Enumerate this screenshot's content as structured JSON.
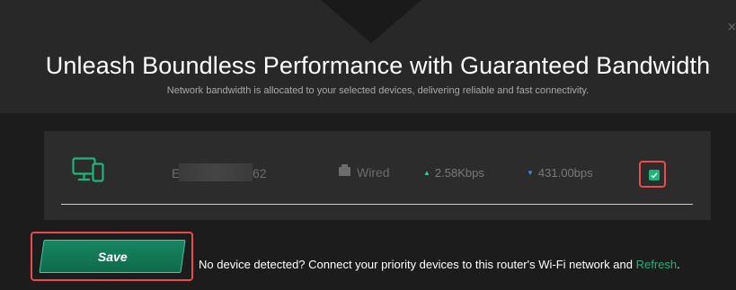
{
  "header": {
    "close_glyph": "×",
    "title": "Unleash Boundless Performance with Guaranteed Bandwidth",
    "subtitle": "Network bandwidth is allocated to your selected devices, delivering reliable and fast connectivity."
  },
  "device": {
    "icon": "devices-icon",
    "name_prefix": "E\\",
    "name_suffix": "62",
    "connection": "Wired",
    "connection_icon": "wired-icon",
    "upload_rate": "2.58Kbps",
    "download_rate": "431.00bps",
    "selected": true
  },
  "actions": {
    "save_label": "Save",
    "hint_text": "No device detected? Connect your priority devices to this router's Wi-Fi network and ",
    "refresh_label": "Refresh",
    "hint_end": "."
  },
  "colors": {
    "accent": "#1fb47a",
    "upload_arrow": "#2fd48f",
    "download_arrow": "#2f8ff0",
    "highlight_outline": "#e84c4c",
    "link": "#23b27a"
  }
}
